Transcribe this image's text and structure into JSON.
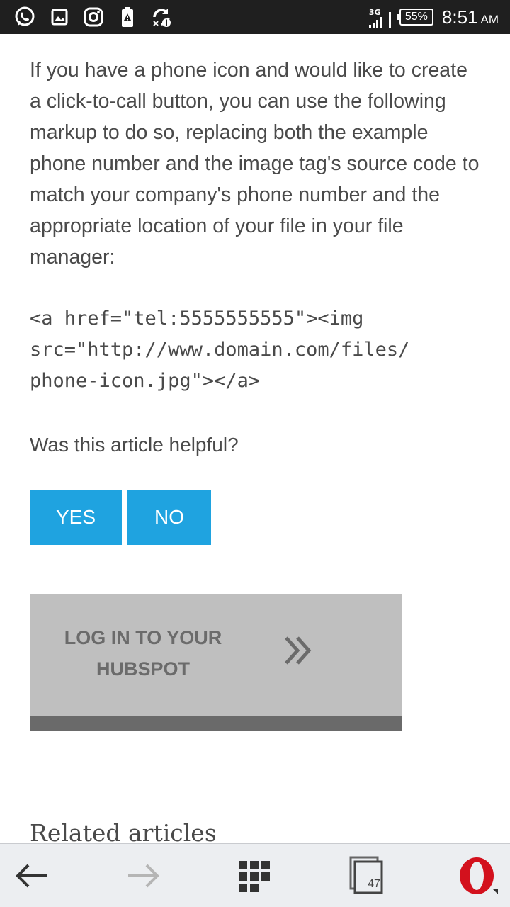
{
  "status_bar": {
    "network": "3G",
    "battery": "55%",
    "time": "8:51",
    "ampm": "AM",
    "icons": [
      "whatsapp-icon",
      "gallery-icon",
      "instagram-icon",
      "battery-alert-icon",
      "sync-info-icon"
    ]
  },
  "article": {
    "paragraph": "If you have a phone icon and would like to create a click-to-call button, you can use the following markup to do so, replacing both the example phone number and the image tag's source code to match your company's phone number and the appropriate location of your file in your file manager:",
    "code_lines": [
      "<a href=\"tel:5555555555\"><img",
      "src=\"http://www.domain.com/files/",
      "phone-icon.jpg\"></a>"
    ]
  },
  "feedback": {
    "question": "Was this article helpful?",
    "yes_label": "YES",
    "no_label": "NO"
  },
  "login_card": {
    "line1": "LOG IN TO YOUR",
    "line2": "HUBSPOT"
  },
  "related": {
    "heading": "Related articles"
  },
  "browser_bar": {
    "tab_count": "47"
  },
  "colors": {
    "accent": "#1fa3e0",
    "status_bar": "#1f1f1f",
    "card": "#bfbfbf",
    "opera_red": "#d3111d"
  }
}
